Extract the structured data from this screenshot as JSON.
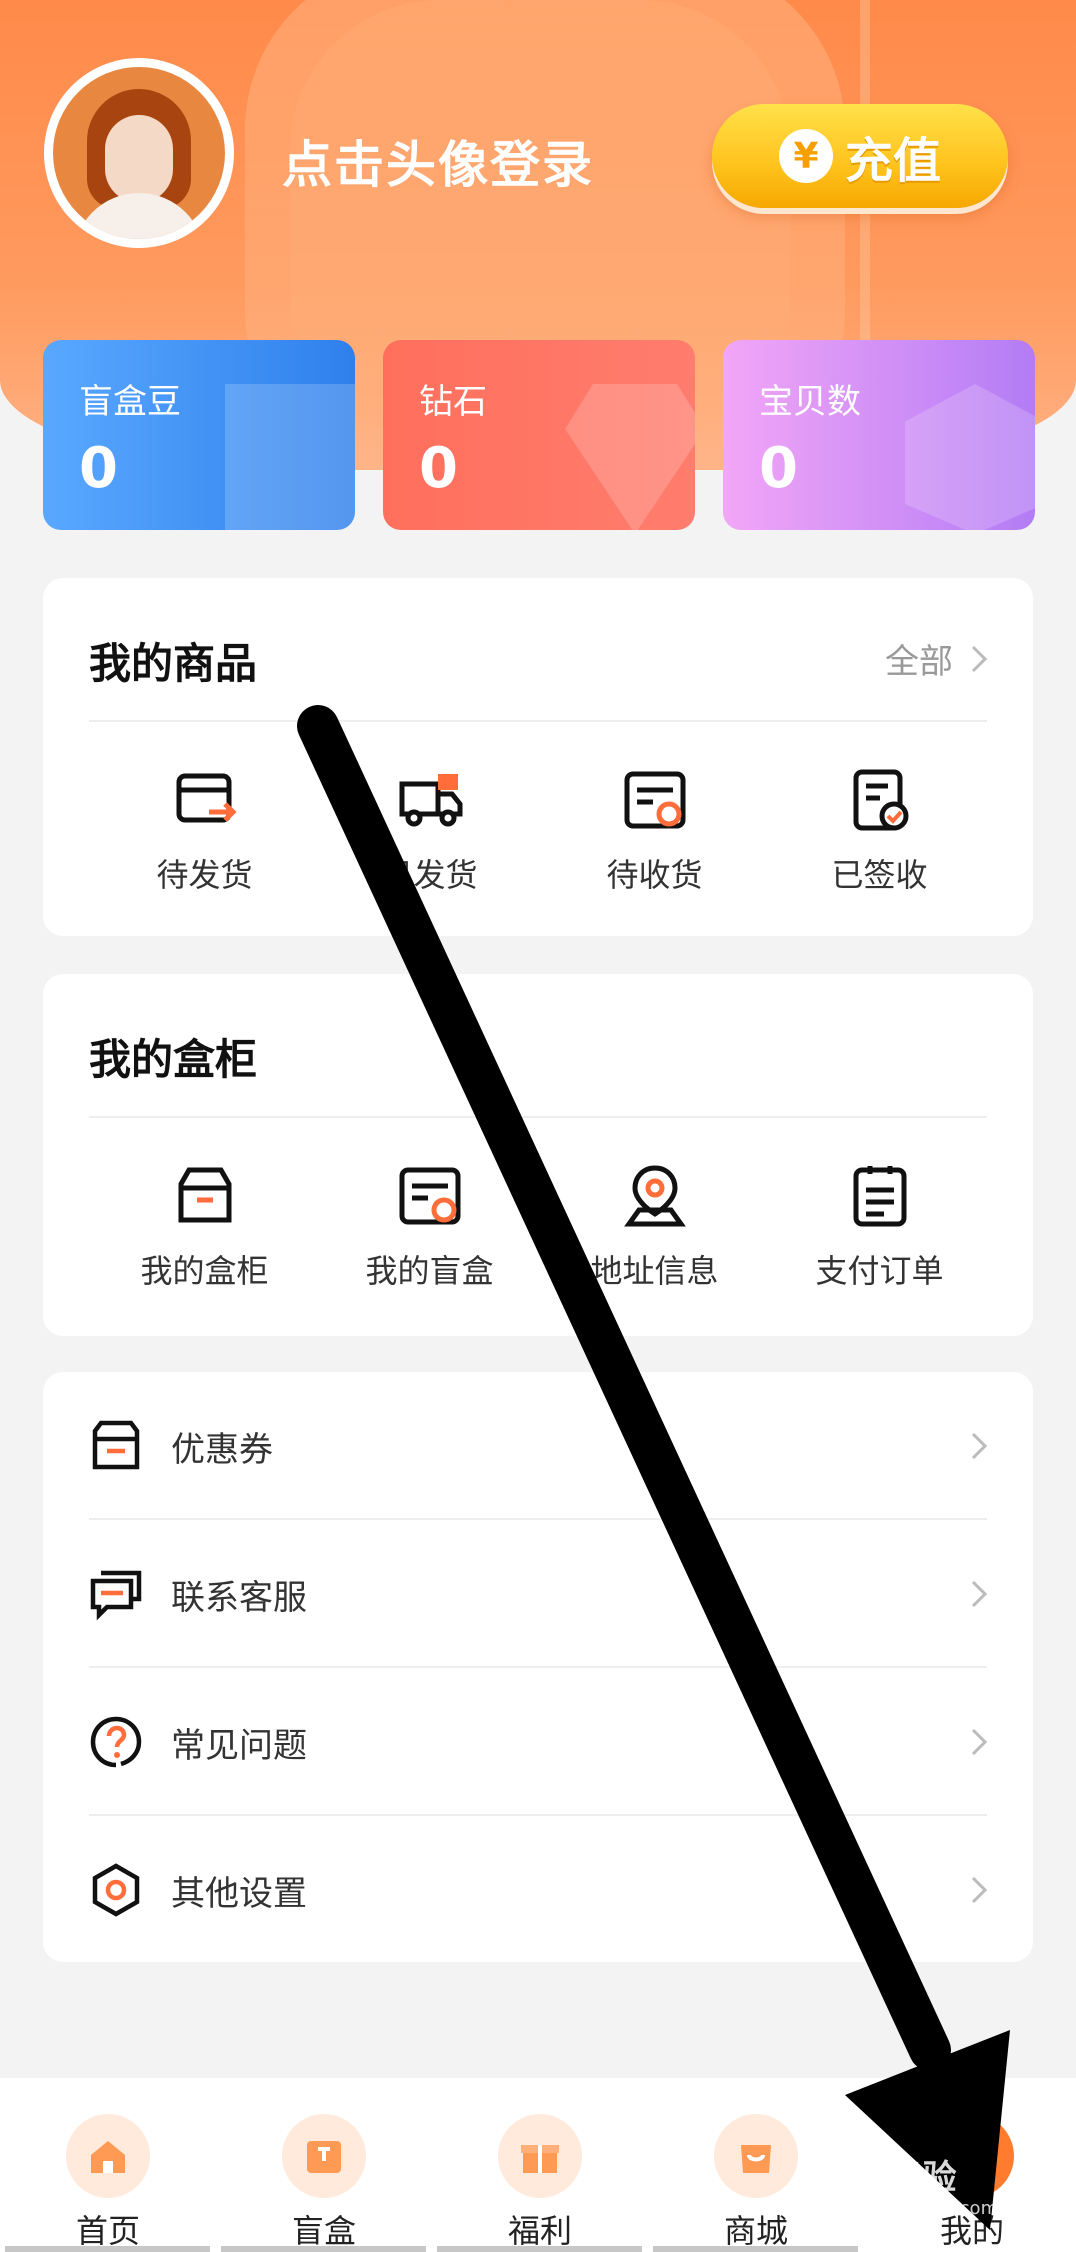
{
  "header": {
    "login_prompt": "点击头像登录",
    "recharge_label": "充值",
    "recharge_symbol": "¥"
  },
  "stats": [
    {
      "label": "盲盒豆",
      "value": "0"
    },
    {
      "label": "钻石",
      "value": "0"
    },
    {
      "label": "宝贝数",
      "value": "0"
    }
  ],
  "goods": {
    "title": "我的商品",
    "more_label": "全部",
    "items": [
      {
        "label": "待发货",
        "icon": "box-arrow-icon"
      },
      {
        "label": "已发货",
        "icon": "truck-icon"
      },
      {
        "label": "待收货",
        "icon": "receipt-clock-icon"
      },
      {
        "label": "已签收",
        "icon": "signed-check-icon"
      }
    ]
  },
  "cabinet": {
    "title": "我的盒柜",
    "items": [
      {
        "label": "我的盒柜",
        "icon": "cabinet-icon"
      },
      {
        "label": "我的盲盒",
        "icon": "blindbox-icon"
      },
      {
        "label": "地址信息",
        "icon": "location-icon"
      },
      {
        "label": "支付订单",
        "icon": "order-icon"
      }
    ]
  },
  "menu": [
    {
      "label": "优惠券",
      "icon": "coupon-icon"
    },
    {
      "label": "联系客服",
      "icon": "service-chat-icon"
    },
    {
      "label": "常见问题",
      "icon": "question-icon"
    },
    {
      "label": "其他设置",
      "icon": "settings-hex-icon"
    }
  ],
  "tabbar": [
    {
      "label": "首页",
      "icon": "home-icon"
    },
    {
      "label": "盲盒",
      "icon": "box-tab-icon"
    },
    {
      "label": "福利",
      "icon": "gift-icon"
    },
    {
      "label": "商城",
      "icon": "shop-bag-icon"
    },
    {
      "label": "我的",
      "icon": "profile-icon",
      "active": true
    }
  ],
  "watermark": {
    "text": "Bai经验",
    "sub": "jingyan.baidu.com"
  },
  "colors": {
    "accent": "#ff7c2e",
    "header": "#ff8a4a",
    "gold": "#ffc21c",
    "blue": "#2f80ec",
    "red": "#ff6f5c",
    "purple": "#b37cf5"
  }
}
